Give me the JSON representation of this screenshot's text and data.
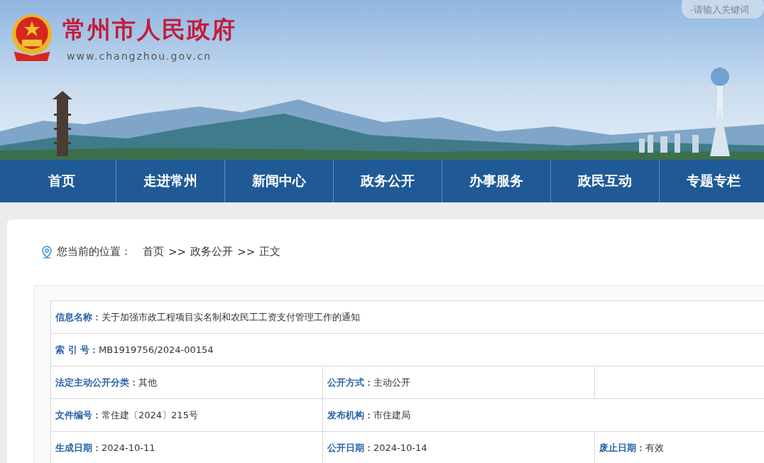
{
  "header": {
    "title": "常州市人民政府",
    "url": "www.changzhou.gov.cn",
    "search": {
      "placeholder": "-请输入关键词"
    }
  },
  "nav": [
    {
      "label": "首页"
    },
    {
      "label": "走进常州"
    },
    {
      "label": "新闻中心"
    },
    {
      "label": "政务公开"
    },
    {
      "label": "办事服务"
    },
    {
      "label": "政民互动"
    },
    {
      "label": "专题专栏"
    }
  ],
  "breadcrumb": {
    "label": "您当前的位置：",
    "items": [
      "首页",
      ">>",
      "政务公开",
      ">>",
      "正文"
    ]
  },
  "info_rows": [
    {
      "kind": "full",
      "cells": [
        {
          "label": "信息名称：",
          "value": "关于加强市政工程项目实名制和农民工工资支付管理工作的通知"
        }
      ]
    },
    {
      "kind": "full",
      "cells": [
        {
          "label": "索 引 号：",
          "value": "MB1919756/2024-00154"
        }
      ]
    },
    {
      "kind": "thirds",
      "cells": [
        {
          "label": "法定主动公开分类：",
          "value": "其他"
        },
        {
          "label": "公开方式：",
          "value": "主动公开"
        }
      ]
    },
    {
      "kind": "split",
      "cells": [
        {
          "label": "文件编号：",
          "value": "常住建〔2024〕215号"
        },
        {
          "label": "发布机构：",
          "value": "市住建局"
        }
      ]
    },
    {
      "kind": "thirds",
      "cells": [
        {
          "label": "生成日期：",
          "value": "2024-10-11"
        },
        {
          "label": "公开日期：",
          "value": "2024-10-14"
        },
        {
          "label": "废止日期：",
          "value": "有效"
        }
      ]
    }
  ]
}
